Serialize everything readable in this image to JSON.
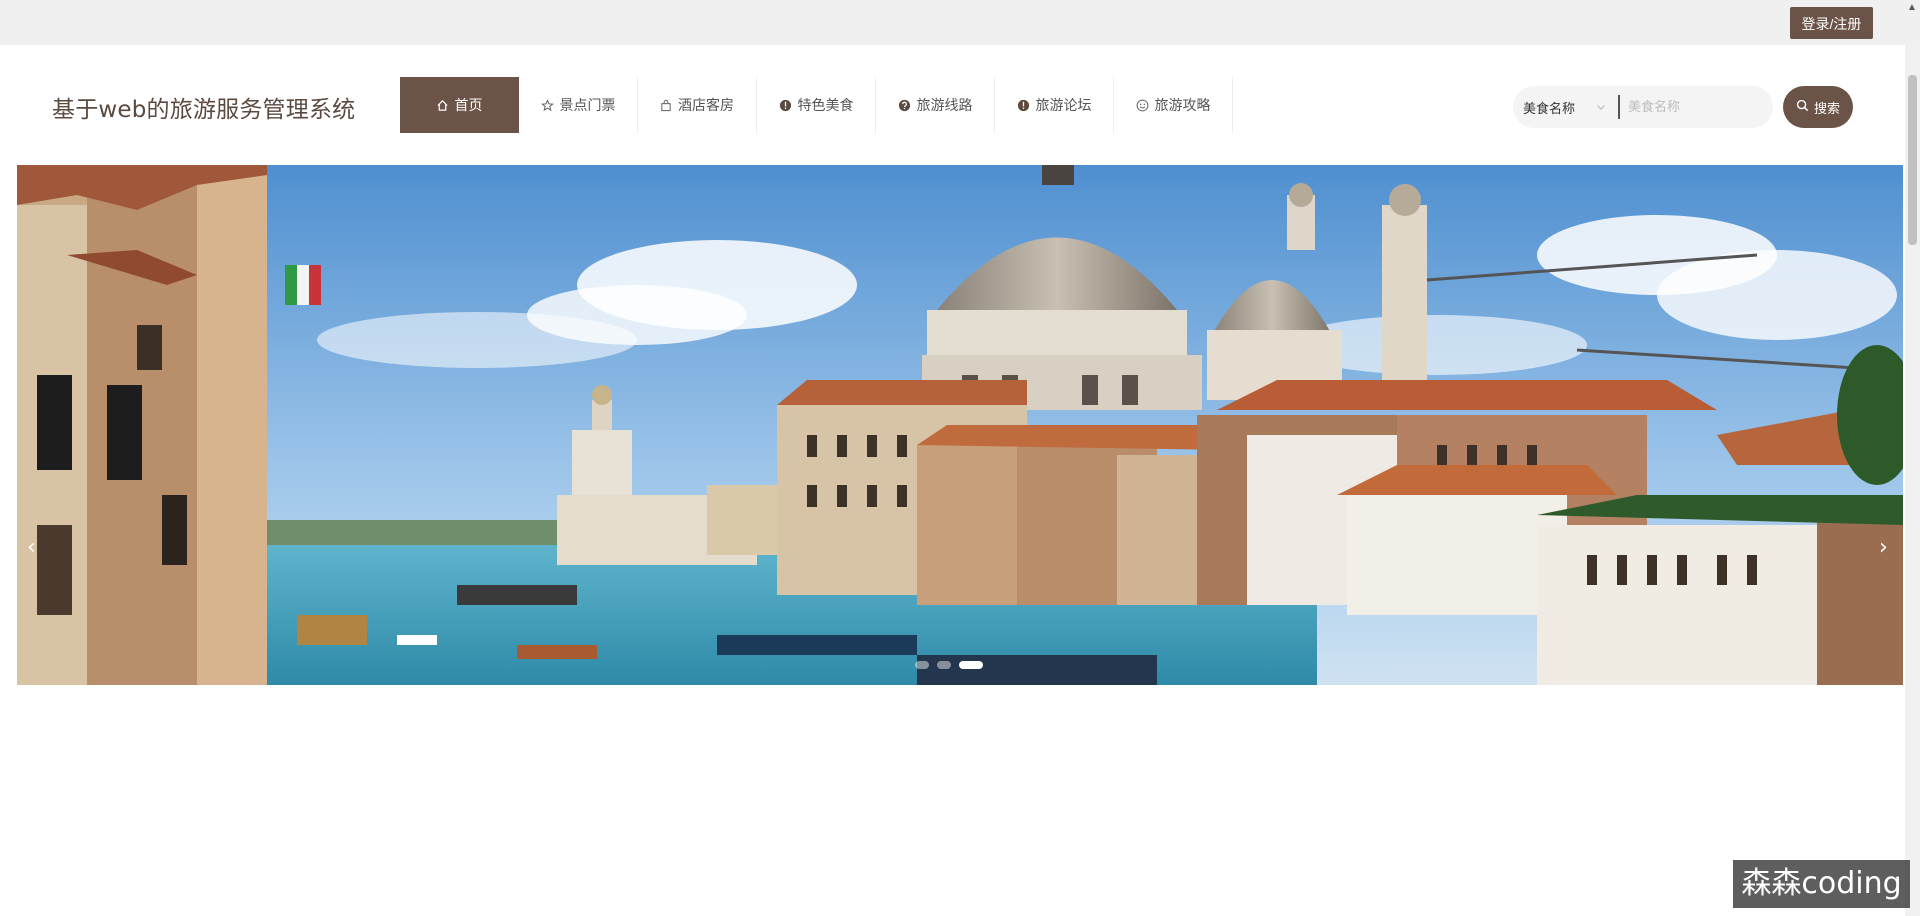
{
  "topbar": {
    "login_label": "登录/注册"
  },
  "header": {
    "title": "基于web的旅游服务管理系统",
    "nav": [
      {
        "label": "首页",
        "icon": "home-icon",
        "active": true
      },
      {
        "label": "景点门票",
        "icon": "star-icon"
      },
      {
        "label": "酒店客房",
        "icon": "bag-icon"
      },
      {
        "label": "特色美食",
        "icon": "info-icon"
      },
      {
        "label": "旅游线路",
        "icon": "question-icon"
      },
      {
        "label": "旅游论坛",
        "icon": "info-icon"
      },
      {
        "label": "旅游攻略",
        "icon": "smile-icon"
      }
    ]
  },
  "search": {
    "select_value": "美食名称",
    "placeholder": "美食名称",
    "button_label": "搜索"
  },
  "banner": {
    "prev": "‹",
    "next": "›",
    "slide_count": 3,
    "active_slide": 3
  },
  "watermark": "森森coding",
  "colors": {
    "accent": "#6b5447",
    "topbar": "#f0f0f0"
  }
}
